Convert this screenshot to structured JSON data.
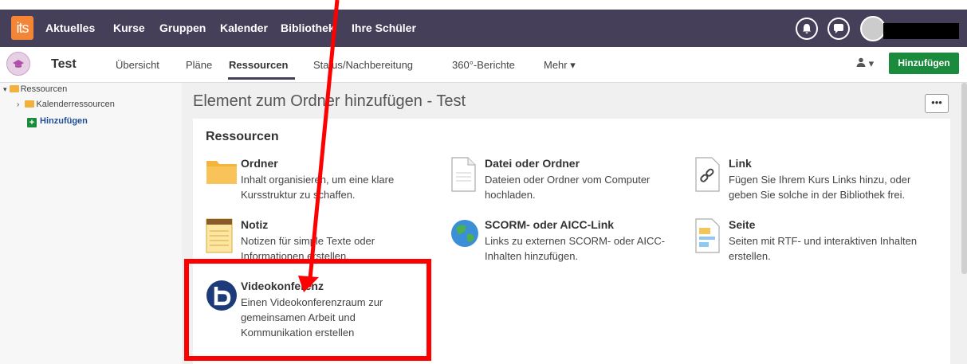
{
  "topnav": {
    "logo_text": "its",
    "items": [
      "Aktuelles",
      "Kurse",
      "Gruppen",
      "Kalender",
      "Bibliothek",
      "Ihre Schüler"
    ],
    "icons": [
      "bell-icon",
      "chat-icon"
    ]
  },
  "course": {
    "title": "Test",
    "tabs": [
      "Übersicht",
      "Pläne",
      "Ressourcen",
      "Status/Nachbereitung",
      "360°-Berichte",
      "Mehr ▾"
    ],
    "active_tab": "Ressourcen",
    "user_menu": "▾",
    "add_button": "Hinzufügen"
  },
  "sidebar": {
    "root": "Ressourcen",
    "child": "Kalenderressourcen",
    "add": "Hinzufügen"
  },
  "main": {
    "title": "Element zum Ordner hinzufügen - Test",
    "more": "•••",
    "section": "Ressourcen",
    "items": [
      {
        "title": "Ordner",
        "desc1": "Inhalt organisieren, um eine klare",
        "desc2": "Kursstruktur zu schaffen."
      },
      {
        "title": "Datei oder Ordner",
        "desc1": "Dateien oder Ordner vom Computer",
        "desc2": "hochladen."
      },
      {
        "title": "Link",
        "desc1": "Fügen Sie Ihrem Kurs Links hinzu, oder",
        "desc2": "geben Sie solche in der Bibliothek frei."
      },
      {
        "title": "Notiz",
        "desc1": "Notizen für simple Texte oder",
        "desc2": "Informationen erstellen."
      },
      {
        "title": "SCORM- oder AICC-Link",
        "desc1": "Links zu externen SCORM- oder AICC-",
        "desc2": "Inhalten hinzufügen."
      },
      {
        "title": "Seite",
        "desc1": "Seiten mit RTF- und interaktiven Inhalten",
        "desc2": "erstellen."
      },
      {
        "title": "Videokonferenz",
        "desc1": "Einen Videokonferenzraum zur",
        "desc2": "gemeinsamen Arbeit und",
        "desc3": "Kommunikation erstellen"
      }
    ]
  },
  "annotation": {
    "color": "#ff0000"
  }
}
